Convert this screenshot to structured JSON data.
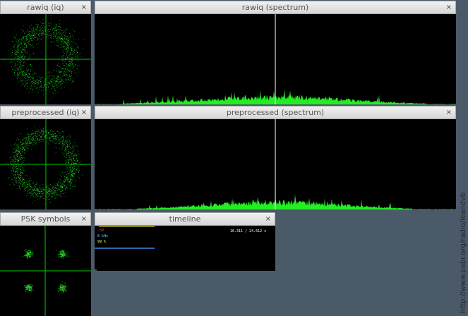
{
  "windows": {
    "rawiq_iq": {
      "title": "rawiq (iq)",
      "close": "×"
    },
    "rawiq_spectrum": {
      "title": "rawiq (spectrum)",
      "close": "×"
    },
    "pre_iq": {
      "title": "preprocessed (iq)",
      "close": "×"
    },
    "pre_spectrum": {
      "title": "preprocessed (spectrum)",
      "close": "×"
    },
    "psk": {
      "title": "PSK symbols",
      "close": "×"
    },
    "timeline": {
      "title": "timeline",
      "close": "×",
      "time_readout": "16.311 / 24.612 s",
      "label1": ".50",
      "label2": "8 kHz",
      "label3": "99 %"
    }
  },
  "watermark": "http://www.pabr.org/radio/leandvb",
  "colors": {
    "plot_green": "#22ee22",
    "axis_green": "#00cc00",
    "background": "#4b5a69"
  }
}
